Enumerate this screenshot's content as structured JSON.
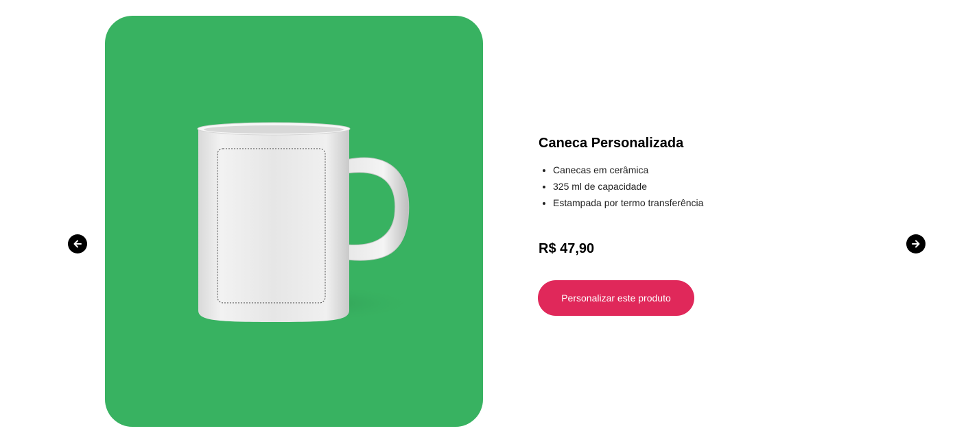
{
  "carousel": {
    "prev_icon": "arrow-left-icon",
    "next_icon": "arrow-right-icon"
  },
  "product": {
    "image_icon": "mug-icon",
    "image_background": "#38b261",
    "title": "Caneca Personalizada",
    "features": [
      "Canecas em cerâmica",
      "325 ml de capacidade",
      "Estampada por termo transferência"
    ],
    "price": "R$ 47,90",
    "cta_label": "Personalizar este produto",
    "cta_color": "#e0285a"
  }
}
